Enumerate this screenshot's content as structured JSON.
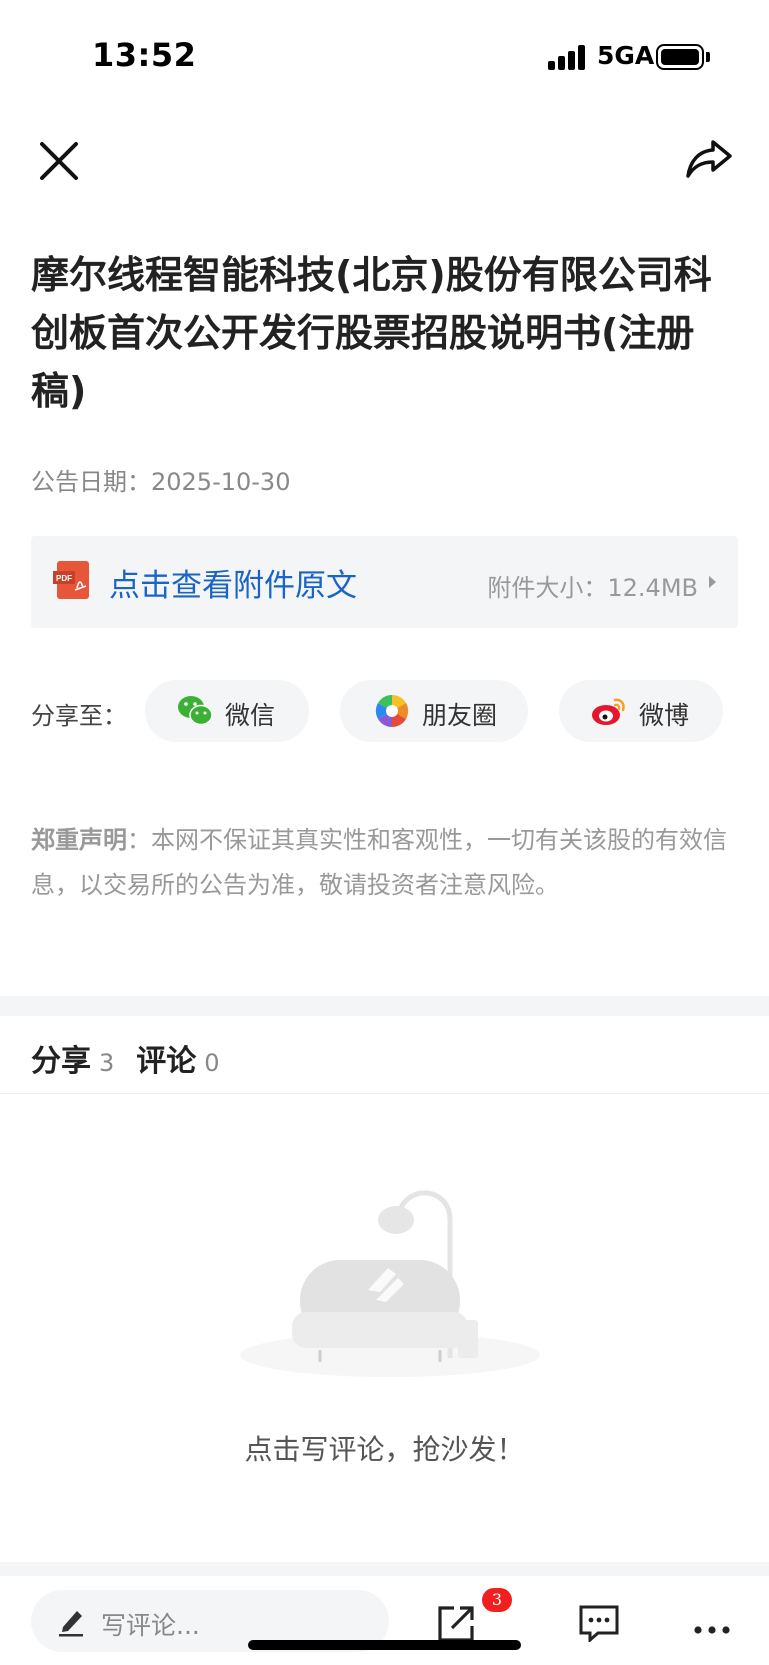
{
  "status_bar": {
    "time": "13:52",
    "network": "5GA"
  },
  "article": {
    "title": "摩尔线程智能科技(北京)股份有限公司科创板首次公开发行股票招股说明书(注册稿)",
    "date_label": "公告日期：2025-10-30"
  },
  "attachment": {
    "link_text": "点击查看附件原文",
    "size_text": "附件大小：12.4MB",
    "icon": "pdf-icon"
  },
  "share": {
    "label": "分享至：",
    "targets": [
      {
        "label": "微信",
        "icon": "wechat-icon"
      },
      {
        "label": "朋友圈",
        "icon": "moments-icon"
      },
      {
        "label": "微博",
        "icon": "weibo-icon"
      }
    ]
  },
  "disclaimer": {
    "heading": "郑重声明",
    "body": "：本网不保证其真实性和客观性，一切有关该股的有效信息，以交易所的公告为准，敬请投资者注意风险。"
  },
  "tabs": [
    {
      "label": "分享",
      "count": "3"
    },
    {
      "label": "评论",
      "count": "0"
    }
  ],
  "empty_state": {
    "text": "点击写评论，抢沙发！"
  },
  "bottom_bar": {
    "comment_placeholder": "写评论...",
    "share_badge": "3"
  },
  "colors": {
    "link": "#1a64c8",
    "badge": "#f02020",
    "muted": "#999999"
  }
}
